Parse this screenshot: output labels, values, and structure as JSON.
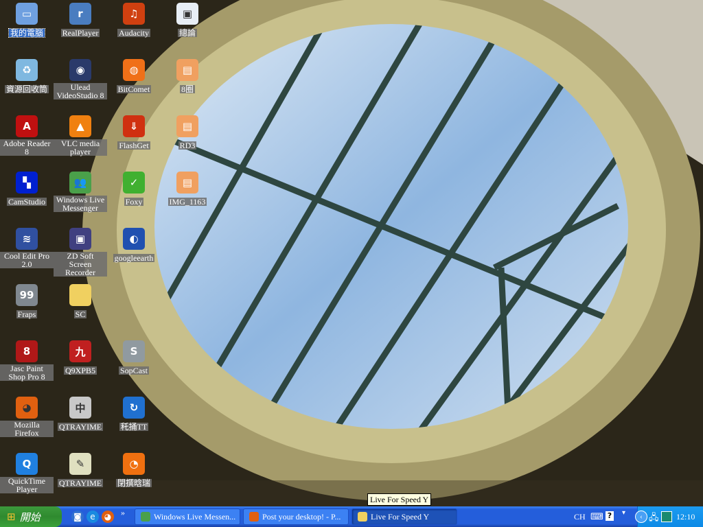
{
  "desktop": {
    "icons": [
      {
        "label": "我的電腦",
        "icon": "my-computer-icon",
        "color": "#6fa0e0",
        "glyph": "▭",
        "selected": true
      },
      {
        "label": "RealPlayer",
        "icon": "realplayer-icon",
        "color": "#4a7dc0",
        "glyph": "r"
      },
      {
        "label": "Audacity",
        "icon": "audacity-icon",
        "color": "#d04010",
        "glyph": "♫"
      },
      {
        "label": "總論",
        "icon": "document-icon",
        "color": "#e8eef5",
        "glyph": "▣"
      },
      {
        "label": "資源回收筒",
        "icon": "recycle-bin-icon",
        "color": "#7fb8e0",
        "glyph": "♻"
      },
      {
        "label": "Ulead VideoStudio 8",
        "icon": "videostudio-icon",
        "color": "#2a3a6a",
        "glyph": "◉"
      },
      {
        "label": "BitComet",
        "icon": "bitcomet-icon",
        "color": "#f07018",
        "glyph": "◍"
      },
      {
        "label": "8圈",
        "icon": "image-file-icon",
        "color": "#f0a060",
        "glyph": "▤"
      },
      {
        "label": "Adobe Reader 8",
        "icon": "adobe-reader-icon",
        "color": "#c01010",
        "glyph": "A"
      },
      {
        "label": "VLC media player",
        "icon": "vlc-icon",
        "color": "#f08010",
        "glyph": "▲"
      },
      {
        "label": "FlashGet",
        "icon": "flashget-icon",
        "color": "#d03010",
        "glyph": "⇓"
      },
      {
        "label": "RD3",
        "icon": "image-file-icon",
        "color": "#f0a060",
        "glyph": "▤"
      },
      {
        "label": "CamStudio",
        "icon": "camstudio-icon",
        "color": "#0020d0",
        "glyph": "▚"
      },
      {
        "label": "Windows Live Messenger",
        "icon": "messenger-icon",
        "color": "#4aa04a",
        "glyph": "👥"
      },
      {
        "label": "Foxy",
        "icon": "foxy-icon",
        "color": "#40b030",
        "glyph": "✓"
      },
      {
        "label": "IMG_1163",
        "icon": "image-file-icon",
        "color": "#f0a060",
        "glyph": "▤"
      },
      {
        "label": "Cool Edit Pro 2.0",
        "icon": "cool-edit-icon",
        "color": "#3050a0",
        "glyph": "≋"
      },
      {
        "label": "ZD Soft Screen Recorder",
        "icon": "screen-recorder-icon",
        "color": "#404080",
        "glyph": "▣"
      },
      {
        "label": "googleearth",
        "icon": "google-earth-icon",
        "color": "#2050b0",
        "glyph": "◐"
      },
      {
        "label": "",
        "icon": "none",
        "color": "",
        "glyph": ""
      },
      {
        "label": "Fraps",
        "icon": "fraps-icon",
        "color": "#808890",
        "glyph": "99"
      },
      {
        "label": "SC",
        "icon": "folder-icon",
        "color": "#f0d060",
        "glyph": ""
      },
      {
        "label": "",
        "icon": "none",
        "color": "",
        "glyph": ""
      },
      {
        "label": "",
        "icon": "none",
        "color": "",
        "glyph": ""
      },
      {
        "label": "Jasc Paint Shop Pro 8",
        "icon": "paint-shop-icon",
        "color": "#b01818",
        "glyph": "8"
      },
      {
        "label": "Q9XPB5",
        "icon": "q9-icon",
        "color": "#c02020",
        "glyph": "九"
      },
      {
        "label": "SopCast",
        "icon": "sopcast-icon",
        "color": "#909aa0",
        "glyph": "S"
      },
      {
        "label": "",
        "icon": "none",
        "color": "",
        "glyph": ""
      },
      {
        "label": "Mozilla Firefox",
        "icon": "firefox-icon",
        "color": "#e06010",
        "glyph": "◕"
      },
      {
        "label": "QTRAYIME",
        "icon": "chinese-ime-icon",
        "color": "#c8c8c8",
        "glyph": "中"
      },
      {
        "label": "秅捅TT",
        "icon": "tt-browser-icon",
        "color": "#2070d0",
        "glyph": "↻"
      },
      {
        "label": "",
        "icon": "none",
        "color": "",
        "glyph": ""
      },
      {
        "label": "QuickTime Player",
        "icon": "quicktime-icon",
        "color": "#2080e0",
        "glyph": "Q"
      },
      {
        "label": "QTRAYIME",
        "icon": "notepad-icon",
        "color": "#e0e0c0",
        "glyph": "✎"
      },
      {
        "label": "閉撰晗瑞",
        "icon": "media-icon",
        "color": "#f07010",
        "glyph": "◔"
      }
    ]
  },
  "tooltip": "Live For Speed Y",
  "taskbar": {
    "start_label": "開始",
    "quick_launch": [
      {
        "icon": "show-desktop-icon",
        "color": "#3070d0",
        "glyph": "◙"
      },
      {
        "icon": "ie-icon",
        "color": "#1a8ae0",
        "glyph": "e"
      },
      {
        "icon": "firefox-icon",
        "color": "#e06010",
        "glyph": "◕"
      }
    ],
    "chevron": "»",
    "tasks": [
      {
        "label": "Windows Live Messen...",
        "icon": "messenger-icon",
        "color": "#4aa04a",
        "active": false
      },
      {
        "label": "Post your desktop! - P...",
        "icon": "firefox-icon",
        "color": "#e06010",
        "active": false
      },
      {
        "label": "Live For Speed Y",
        "icon": "folder-icon",
        "color": "#f0d060",
        "active": true
      }
    ],
    "language": "CH",
    "tray_clock": "12:10"
  }
}
